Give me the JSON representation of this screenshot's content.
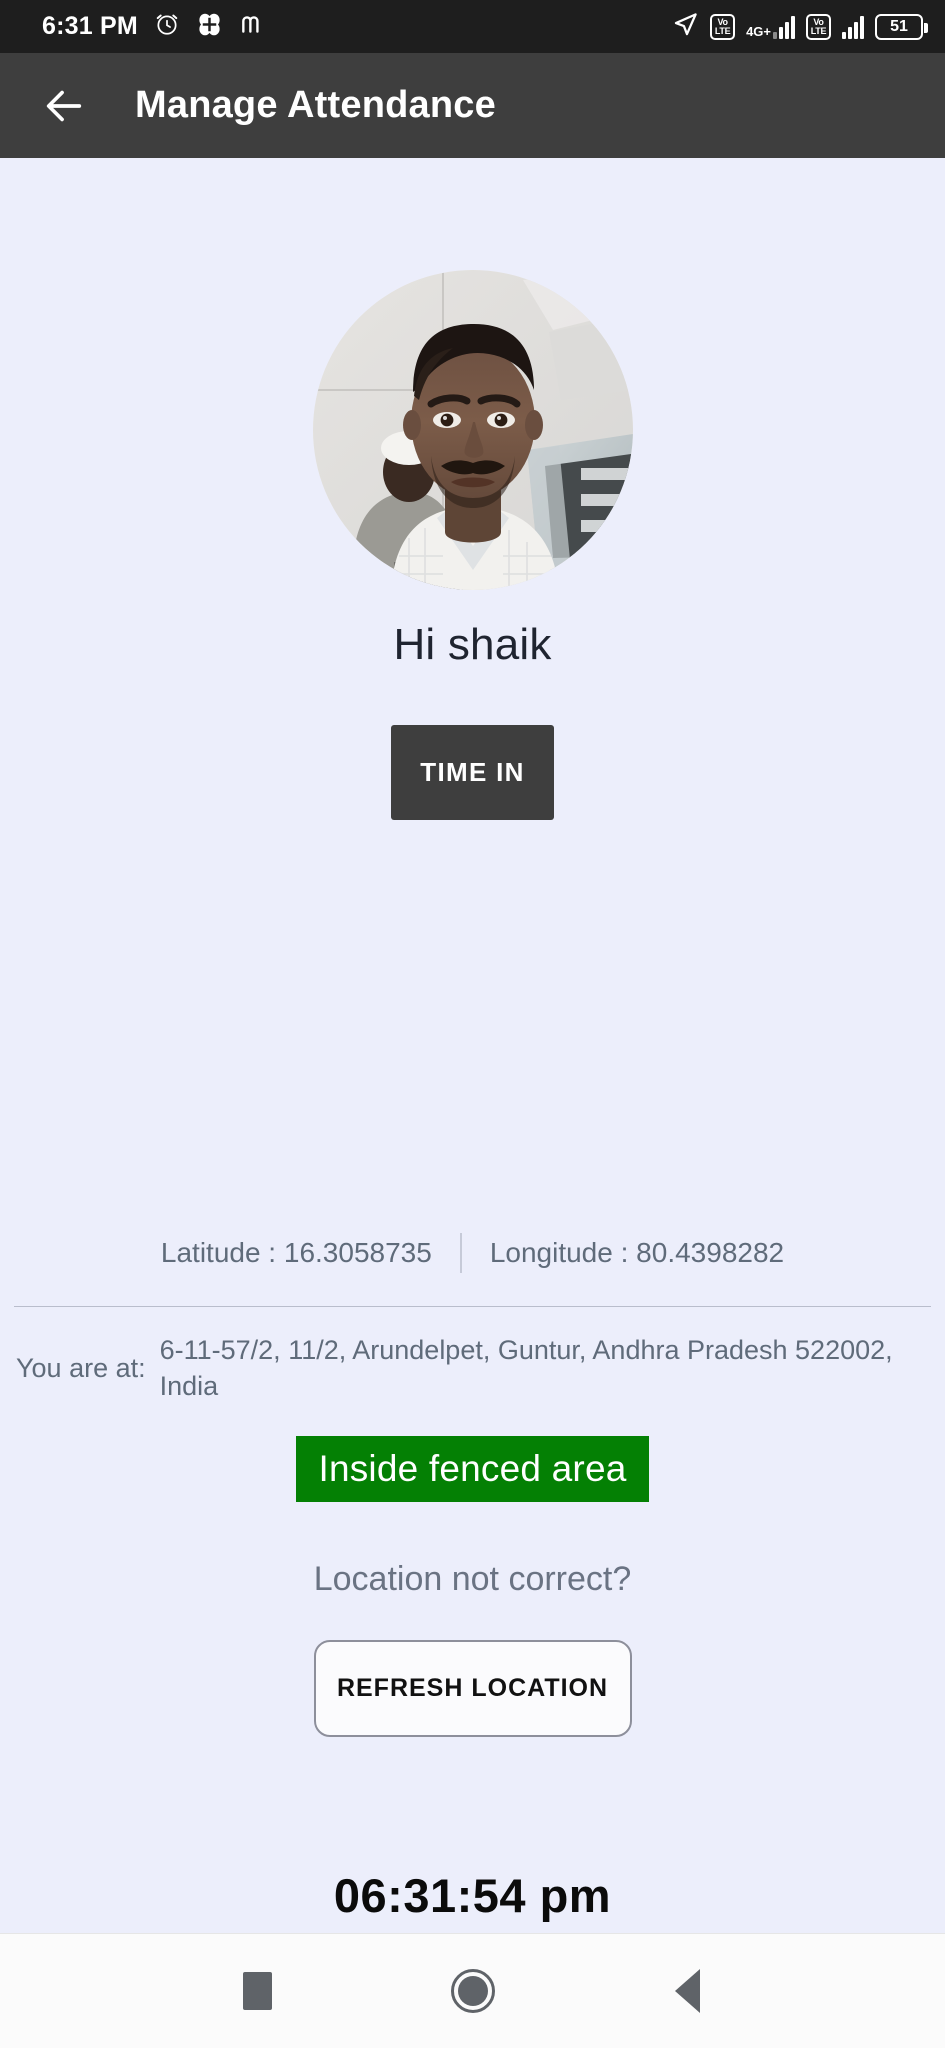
{
  "status_bar": {
    "time": "6:31 PM",
    "icons_left": [
      "alarm-clock-icon",
      "app-badge-icon",
      "app-m-icon"
    ],
    "icons_right": [
      "location-arrow-icon",
      "volte-icon",
      "network-4gplus-icon",
      "signal-bars-icon",
      "volte-icon-2",
      "signal-bars-icon-2",
      "battery-icon"
    ],
    "network_label": "4G+",
    "volte_top": "Vo",
    "volte_bottom": "LTE",
    "battery_level": "51",
    "background_color": "#1e1e1e"
  },
  "app_bar": {
    "title": "Manage Attendance",
    "back_icon": "arrow-left-icon",
    "background_color": "#3e3e3e"
  },
  "profile": {
    "avatar_alt": "user-profile-photo",
    "greeting": "Hi shaik"
  },
  "actions": {
    "time_in_label": "TIME IN",
    "time_in_color": "#3e3e3e",
    "refresh_label": "REFRESH LOCATION"
  },
  "location": {
    "latitude_label": "Latitude  :",
    "latitude_value": "16.3058735",
    "longitude_label": "Longitude  :",
    "longitude_value": "80.4398282",
    "address_label": "You are at:",
    "address_value": "6-11-57/2, 11/2, Arundelpet, Guntur, Andhra Pradesh 522002, India",
    "fence_status": "Inside fenced area",
    "fence_color": "#048004",
    "not_correct_prompt": "Location not correct?"
  },
  "clock": {
    "current_time": "06:31:54 pm"
  },
  "nav_bar": {
    "recents": "recents-square-icon",
    "home": "home-circle-icon",
    "back": "back-triangle-icon"
  },
  "theme": {
    "page_background": "#eceefb",
    "muted_text": "#5f6b7a"
  }
}
